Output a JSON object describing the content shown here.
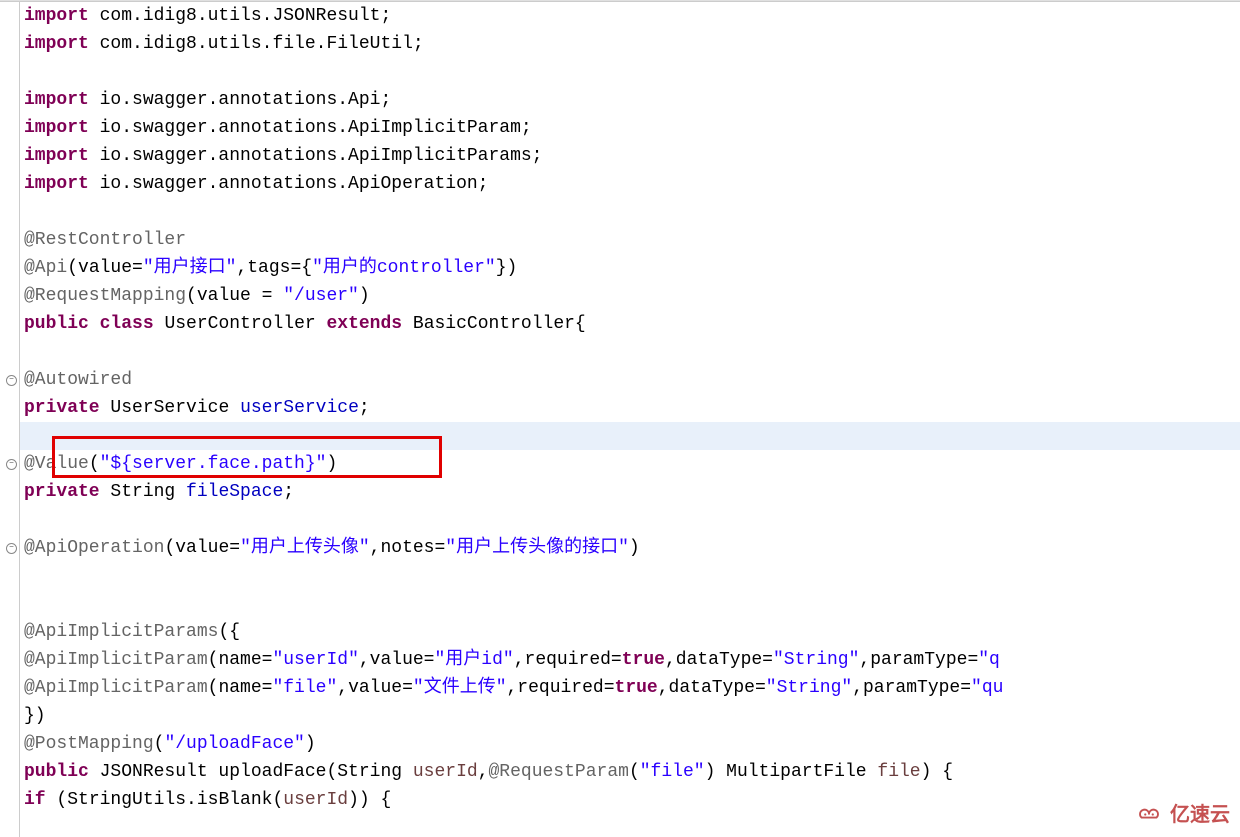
{
  "code": {
    "lines": [
      {
        "indent": 0,
        "segs": [
          {
            "cls": "kw",
            "t": "import"
          },
          {
            "cls": "plain",
            "t": " com.idig8.utils.JSONResult;"
          }
        ]
      },
      {
        "indent": 0,
        "segs": [
          {
            "cls": "kw",
            "t": "import"
          },
          {
            "cls": "plain",
            "t": " com.idig8.utils.file.FileUtil;"
          }
        ]
      },
      {
        "indent": 0,
        "segs": []
      },
      {
        "indent": 0,
        "segs": [
          {
            "cls": "kw",
            "t": "import"
          },
          {
            "cls": "plain",
            "t": " io.swagger.annotations.Api;"
          }
        ]
      },
      {
        "indent": 0,
        "segs": [
          {
            "cls": "kw",
            "t": "import"
          },
          {
            "cls": "plain",
            "t": " io.swagger.annotations.ApiImplicitParam;"
          }
        ]
      },
      {
        "indent": 0,
        "segs": [
          {
            "cls": "kw",
            "t": "import"
          },
          {
            "cls": "plain",
            "t": " io.swagger.annotations.ApiImplicitParams;"
          }
        ]
      },
      {
        "indent": 0,
        "segs": [
          {
            "cls": "kw",
            "t": "import"
          },
          {
            "cls": "plain",
            "t": " io.swagger.annotations.ApiOperation;"
          }
        ]
      },
      {
        "indent": 0,
        "segs": []
      },
      {
        "indent": 0,
        "segs": [
          {
            "cls": "ann",
            "t": "@RestController"
          }
        ]
      },
      {
        "indent": 0,
        "segs": [
          {
            "cls": "ann",
            "t": "@Api"
          },
          {
            "cls": "plain",
            "t": "(value="
          },
          {
            "cls": "str",
            "t": "\"用户接口\""
          },
          {
            "cls": "plain",
            "t": ",tags={"
          },
          {
            "cls": "str",
            "t": "\"用户的controller\""
          },
          {
            "cls": "plain",
            "t": "})"
          }
        ]
      },
      {
        "indent": 0,
        "segs": [
          {
            "cls": "ann",
            "t": "@RequestMapping"
          },
          {
            "cls": "plain",
            "t": "(value = "
          },
          {
            "cls": "str",
            "t": "\"/user\""
          },
          {
            "cls": "plain",
            "t": ")"
          }
        ]
      },
      {
        "indent": 0,
        "segs": [
          {
            "cls": "kw",
            "t": "public"
          },
          {
            "cls": "plain",
            "t": " "
          },
          {
            "cls": "kw",
            "t": "class"
          },
          {
            "cls": "plain",
            "t": " UserController "
          },
          {
            "cls": "kw",
            "t": "extends"
          },
          {
            "cls": "plain",
            "t": " BasicController{"
          }
        ]
      },
      {
        "indent": 0,
        "segs": []
      },
      {
        "indent": 1,
        "fold": true,
        "segs": [
          {
            "cls": "ann",
            "t": "@Autowired"
          }
        ]
      },
      {
        "indent": 1,
        "segs": [
          {
            "cls": "kw",
            "t": "private"
          },
          {
            "cls": "plain",
            "t": " UserService "
          },
          {
            "cls": "mem",
            "t": "userService"
          },
          {
            "cls": "plain",
            "t": ";"
          }
        ]
      },
      {
        "indent": 1,
        "highlight": true,
        "segs": []
      },
      {
        "indent": 1,
        "fold": true,
        "boxed": true,
        "segs": [
          {
            "cls": "ann",
            "t": "@Value"
          },
          {
            "cls": "plain",
            "t": "("
          },
          {
            "cls": "str",
            "t": "\"${server.face.path}\""
          },
          {
            "cls": "plain",
            "t": ")"
          }
        ]
      },
      {
        "indent": 1,
        "segs": [
          {
            "cls": "kw",
            "t": "private"
          },
          {
            "cls": "plain",
            "t": " String "
          },
          {
            "cls": "mem",
            "t": "fileSpace"
          },
          {
            "cls": "plain",
            "t": ";"
          }
        ]
      },
      {
        "indent": 0,
        "segs": []
      },
      {
        "indent": 1,
        "fold": true,
        "segs": [
          {
            "cls": "ann",
            "t": "@ApiOperation"
          },
          {
            "cls": "plain",
            "t": "(value="
          },
          {
            "cls": "str",
            "t": "\"用户上传头像\""
          },
          {
            "cls": "plain",
            "t": ",notes="
          },
          {
            "cls": "str",
            "t": "\"用户上传头像的接口\""
          },
          {
            "cls": "plain",
            "t": ")"
          }
        ]
      },
      {
        "indent": 0,
        "segs": []
      },
      {
        "indent": 0,
        "segs": []
      },
      {
        "indent": 1,
        "segs": [
          {
            "cls": "ann",
            "t": "@ApiImplicitParams"
          },
          {
            "cls": "plain",
            "t": "({"
          }
        ]
      },
      {
        "indent": 2,
        "segs": [
          {
            "cls": "ann",
            "t": "@ApiImplicitParam"
          },
          {
            "cls": "plain",
            "t": "(name="
          },
          {
            "cls": "str",
            "t": "\"userId\""
          },
          {
            "cls": "plain",
            "t": ",value="
          },
          {
            "cls": "str",
            "t": "\"用户id\""
          },
          {
            "cls": "plain",
            "t": ",required="
          },
          {
            "cls": "kw",
            "t": "true"
          },
          {
            "cls": "plain",
            "t": ",dataType="
          },
          {
            "cls": "str",
            "t": "\"String\""
          },
          {
            "cls": "plain",
            "t": ",paramType="
          },
          {
            "cls": "str",
            "t": "\"q"
          }
        ]
      },
      {
        "indent": 2,
        "segs": [
          {
            "cls": "ann",
            "t": "@ApiImplicitParam"
          },
          {
            "cls": "plain",
            "t": "(name="
          },
          {
            "cls": "str",
            "t": "\"file\""
          },
          {
            "cls": "plain",
            "t": ",value="
          },
          {
            "cls": "str",
            "t": "\"文件上传\""
          },
          {
            "cls": "plain",
            "t": ",required="
          },
          {
            "cls": "kw",
            "t": "true"
          },
          {
            "cls": "plain",
            "t": ",dataType="
          },
          {
            "cls": "str",
            "t": "\"String\""
          },
          {
            "cls": "plain",
            "t": ",paramType="
          },
          {
            "cls": "str",
            "t": "\"qu"
          }
        ]
      },
      {
        "indent": 1,
        "segs": [
          {
            "cls": "plain",
            "t": "})"
          }
        ]
      },
      {
        "indent": 1,
        "segs": [
          {
            "cls": "ann",
            "t": "@PostMapping"
          },
          {
            "cls": "plain",
            "t": "("
          },
          {
            "cls": "str",
            "t": "\"/uploadFace\""
          },
          {
            "cls": "plain",
            "t": ")"
          }
        ]
      },
      {
        "indent": 1,
        "segs": [
          {
            "cls": "kw",
            "t": "public"
          },
          {
            "cls": "plain",
            "t": " JSONResult uploadFace(String "
          },
          {
            "cls": "param",
            "t": "userId"
          },
          {
            "cls": "plain",
            "t": ","
          },
          {
            "cls": "ann",
            "t": "@RequestParam"
          },
          {
            "cls": "plain",
            "t": "("
          },
          {
            "cls": "str",
            "t": "\"file\""
          },
          {
            "cls": "plain",
            "t": ") MultipartFile "
          },
          {
            "cls": "param",
            "t": "file"
          },
          {
            "cls": "plain",
            "t": ") {"
          }
        ]
      },
      {
        "indent": 2,
        "segs": [
          {
            "cls": "kw",
            "t": "if"
          },
          {
            "cls": "plain",
            "t": " (StringUtils."
          },
          {
            "cls": "plain",
            "t": "isBlank"
          },
          {
            "cls": "plain",
            "t": "("
          },
          {
            "cls": "param",
            "t": "userId"
          },
          {
            "cls": "plain",
            "t": ")) {"
          }
        ]
      }
    ]
  },
  "watermark": {
    "text": "亿速云"
  }
}
